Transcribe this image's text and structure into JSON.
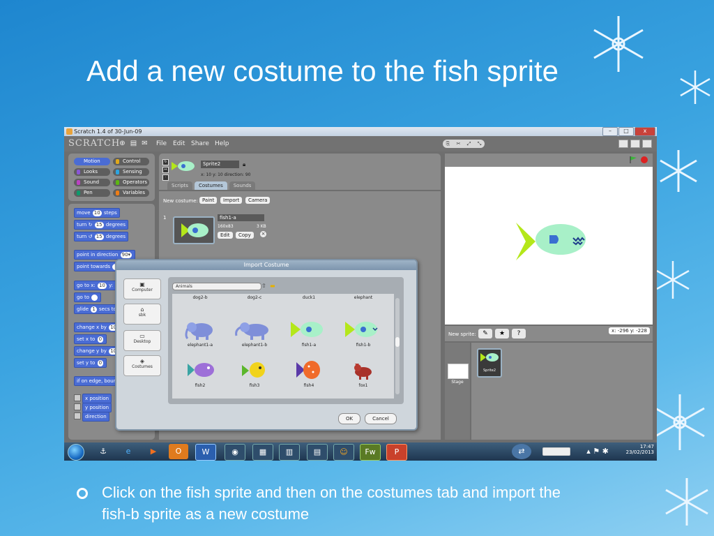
{
  "slide": {
    "title": "Add a new costume to the fish sprite",
    "bullet": "Click on the fish sprite and then on the costumes tab and import the fish-b sprite as a new costume"
  },
  "window": {
    "title": "Scratch 1.4 of 30-Jun-09",
    "controls": [
      "–",
      "□",
      "x"
    ]
  },
  "menubar": {
    "logo": "SCRATCH",
    "items": [
      "File",
      "Edit",
      "Share",
      "Help"
    ]
  },
  "categories": [
    {
      "label": "Motion",
      "color": "#4a6cd4",
      "active": true
    },
    {
      "label": "Control",
      "color": "#e1a91a",
      "active": false
    },
    {
      "label": "Looks",
      "color": "#8a55d7",
      "active": false
    },
    {
      "label": "Sensing",
      "color": "#2ca5e2",
      "active": false
    },
    {
      "label": "Sound",
      "color": "#bb42c3",
      "active": false
    },
    {
      "label": "Operators",
      "color": "#5cb712",
      "active": false
    },
    {
      "label": "Pen",
      "color": "#0e9a6c",
      "active": false
    },
    {
      "label": "Variables",
      "color": "#ee7d16",
      "active": false
    }
  ],
  "blocks": {
    "move": {
      "pre": "move",
      "val": "10",
      "post": "steps"
    },
    "turn_cw": {
      "pre": "turn ↻",
      "val": "15",
      "post": "degrees"
    },
    "turn_ccw": {
      "pre": "turn ↺",
      "val": "15",
      "post": "degrees"
    },
    "point_dir": {
      "pre": "point in direction",
      "val": "90▾"
    },
    "point_towards": {
      "pre": "point towards"
    },
    "go_to_xy": {
      "pre": "go to x:",
      "val": "10",
      "post": "y:"
    },
    "go_to": {
      "pre": "go to"
    },
    "glide": {
      "pre": "glide",
      "val": "1",
      "post": "secs to"
    },
    "change_x": {
      "pre": "change x by",
      "val": "10"
    },
    "set_x": {
      "pre": "set x to",
      "val": "0"
    },
    "change_y": {
      "pre": "change y by",
      "val": "10"
    },
    "set_y": {
      "pre": "set y to",
      "val": "0"
    },
    "bounce": {
      "pre": "if on edge, bounce"
    },
    "x_position": "x position",
    "y_position": "y position",
    "direction": "direction"
  },
  "sprite": {
    "name": "Sprite2",
    "coords": "x: 10   y: 10   direction: 90",
    "tabs": [
      "Scripts",
      "Costumes",
      "Sounds"
    ],
    "active_tab": "Costumes"
  },
  "costumes": {
    "new_costume_label": "New costume:",
    "buttons": [
      "Paint",
      "Import",
      "Camera"
    ],
    "item": {
      "index": "1",
      "name": "fish1-a",
      "size": "160x83",
      "kb": "3 KB",
      "edit": "Edit",
      "copy": "Copy"
    }
  },
  "stage_panel": {
    "new_sprite_label": "New sprite:",
    "mouse_xy": "x: -296   y: -228",
    "sprite_tile": "Sprite2",
    "stage_label": "Stage"
  },
  "dialog": {
    "title": "Import Costume",
    "sidebar": [
      "Computer",
      "sbk",
      "Desktop",
      "Costumes"
    ],
    "folder": "Animals",
    "top_row": [
      "dog2-b",
      "dog2-c",
      "duck1",
      "elephant"
    ],
    "row1": [
      "elephant1-a",
      "elephant1-b",
      "fish1-a",
      "fish1-b"
    ],
    "row2": [
      "fish2",
      "fish3",
      "fish4",
      "fox1"
    ],
    "ok": "OK",
    "cancel": "Cancel"
  },
  "taskbar": {
    "time": "17:47",
    "date": "23/02/2013"
  },
  "colors": {
    "motion_blue": "#4a6cd4",
    "fish_green": "#b4e71a",
    "fish_body": "#a8f0c8",
    "scratch_gray": "#8a8a8a"
  }
}
